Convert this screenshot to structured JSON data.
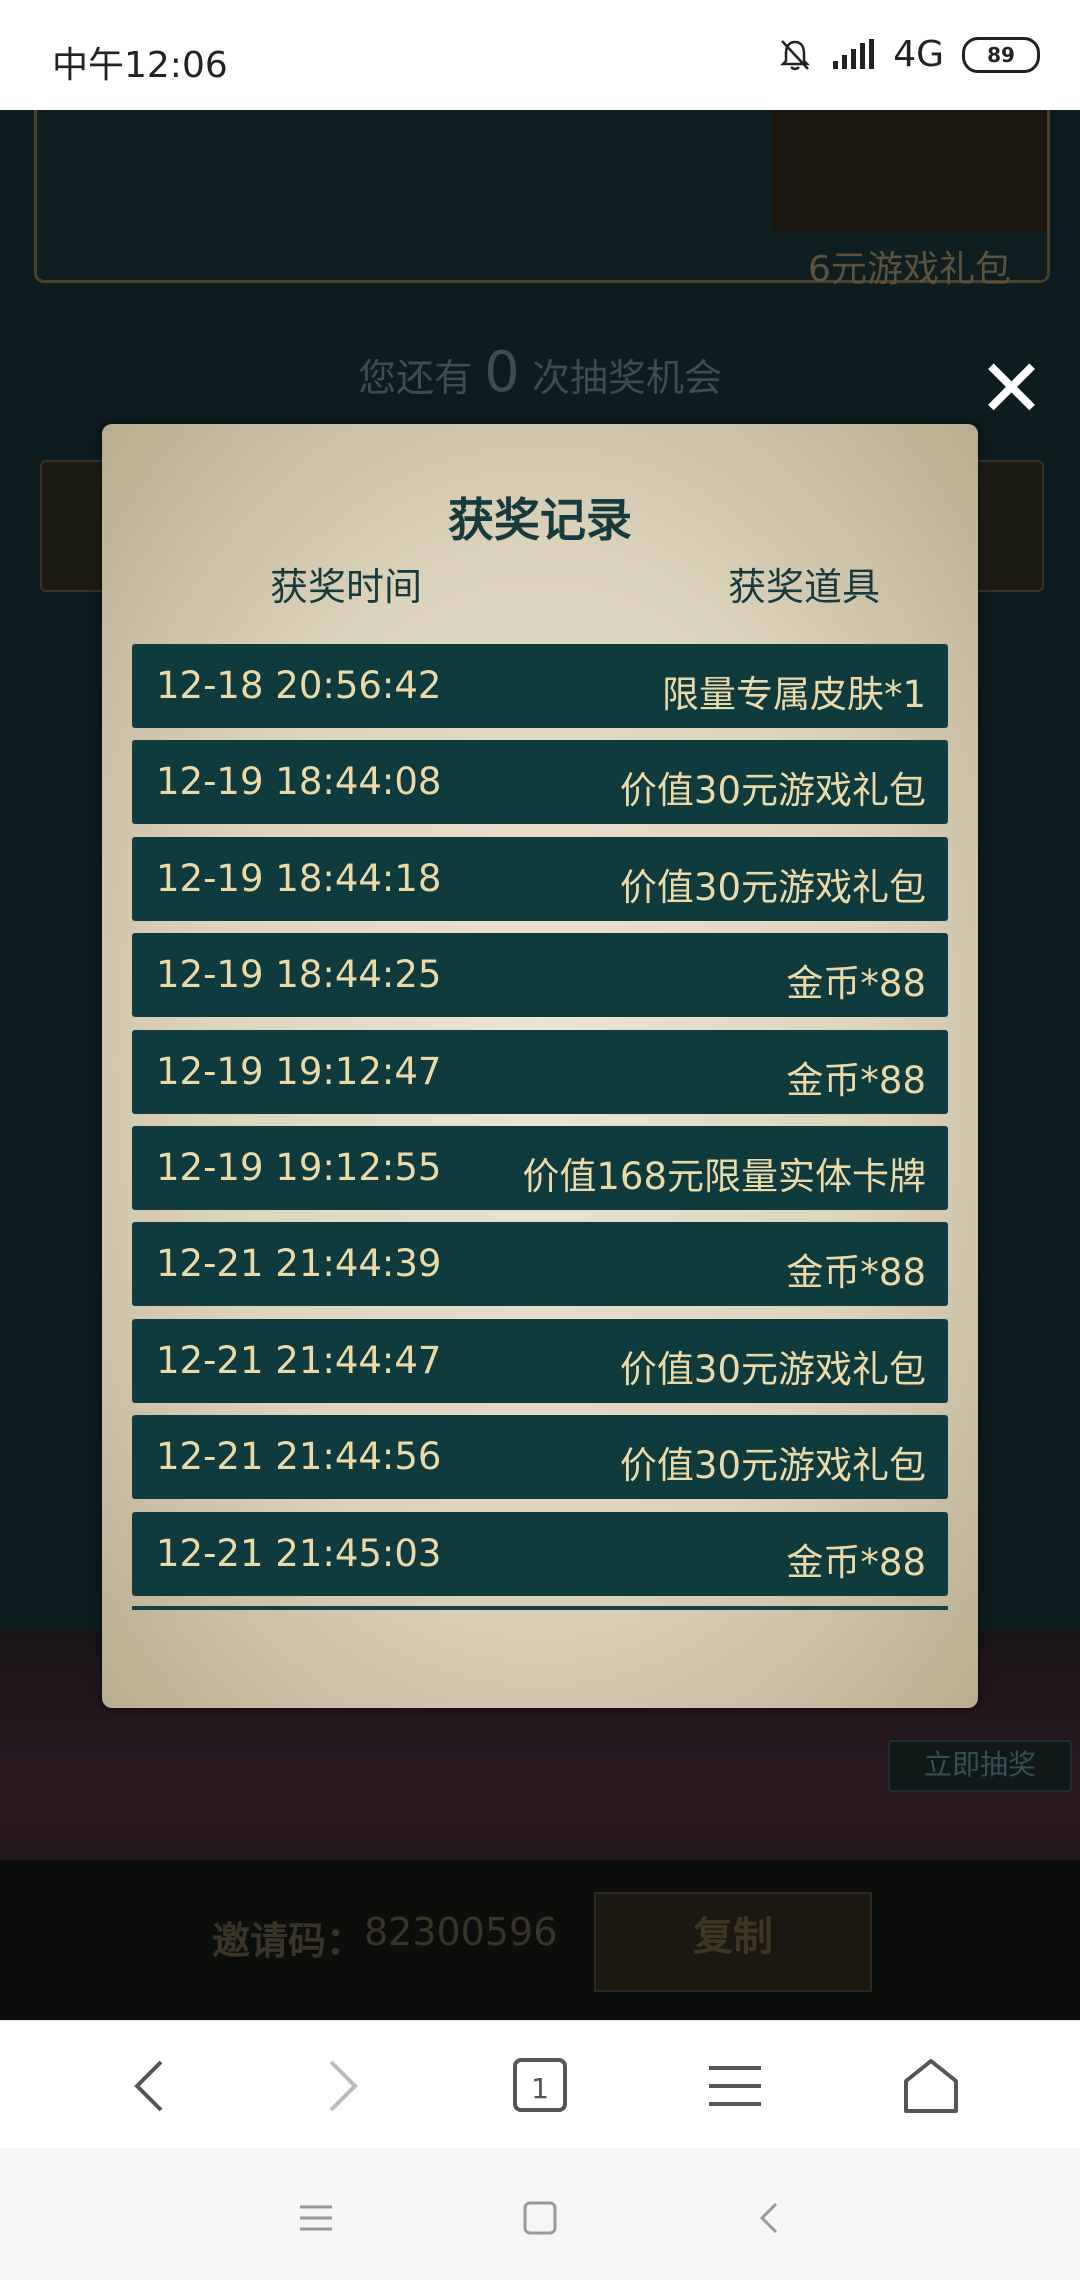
{
  "status_bar": {
    "time": "中午12:06",
    "network": "4G",
    "battery": "89"
  },
  "background_page": {
    "prize_label": "6元游戏礼包",
    "chances_prefix": "您还有",
    "chances_count": "0",
    "chances_suffix": "次抽奖机会",
    "lottery_button": "立即抽奖",
    "invite_label": "邀请码：",
    "invite_code": "82300596",
    "copy_button": "复制"
  },
  "modal": {
    "title": "获奖记录",
    "col_time": "获奖时间",
    "col_item": "获奖道具",
    "close_symbol": "✕",
    "records": [
      {
        "time": "12-18 20:56:42",
        "item": "限量专属皮肤*1"
      },
      {
        "time": "12-19 18:44:08",
        "item": "价值30元游戏礼包"
      },
      {
        "time": "12-19 18:44:18",
        "item": "价值30元游戏礼包"
      },
      {
        "time": "12-19 18:44:25",
        "item": "金币*88"
      },
      {
        "time": "12-19 19:12:47",
        "item": "金币*88"
      },
      {
        "time": "12-19 19:12:55",
        "item": "价值168元限量实体卡牌"
      },
      {
        "time": "12-21 21:44:39",
        "item": "金币*88"
      },
      {
        "time": "12-21 21:44:47",
        "item": "价值30元游戏礼包"
      },
      {
        "time": "12-21 21:44:56",
        "item": "价值30元游戏礼包"
      },
      {
        "time": "12-21 21:45:03",
        "item": "金币*88"
      }
    ]
  },
  "browser_toolbar": {
    "tab_count": "1",
    "icons": [
      "back-icon",
      "forward-icon",
      "tabs-icon",
      "menu-icon",
      "home-icon"
    ]
  },
  "system_nav": {
    "icons": [
      "recent-apps-icon",
      "home-icon",
      "back-icon"
    ]
  }
}
